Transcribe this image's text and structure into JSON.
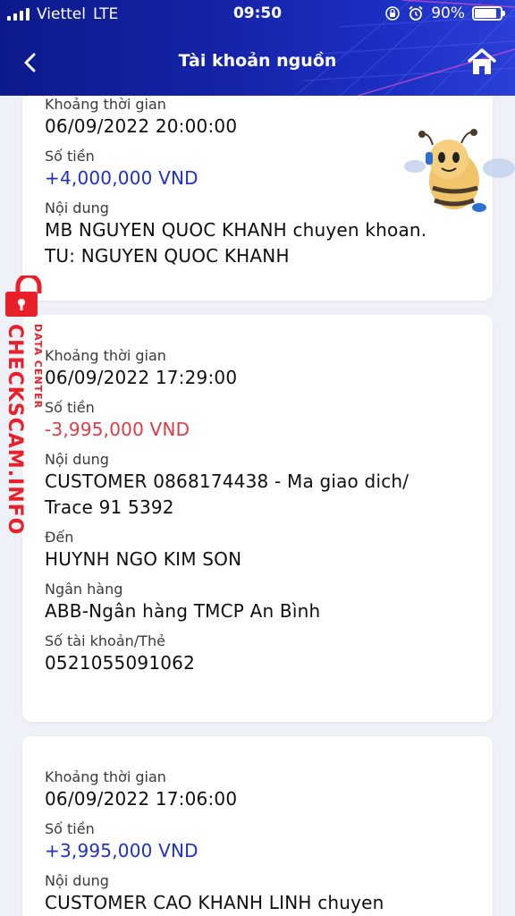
{
  "status_bar": {
    "carrier": "Viettel",
    "network": "LTE",
    "time": "09:50",
    "battery": "90%"
  },
  "header": {
    "title": "Tài khoản nguồn"
  },
  "watermark": {
    "main": "CHECKSCAM.INFO",
    "sub": "DATA CENTER"
  },
  "transactions": [
    {
      "time_label": "Khoảng thời gian",
      "time": "06/09/2022 20:00:00",
      "amount_label": "Số tiền",
      "amount": "+4,000,000 VND",
      "content_label": "Nội dung",
      "content": "MB NGUYEN QUOC KHANH chuyen khoan. TU: NGUYEN QUOC KHANH"
    },
    {
      "time_label": "Khoảng thời gian",
      "time": "06/09/2022 17:29:00",
      "amount_label": "Số tiền",
      "amount": "-3,995,000 VND",
      "content_label": "Nội dung",
      "content": "CUSTOMER 0868174438 - Ma giao dich/ Trace 91 5392",
      "to_label": "Đến",
      "to": "HUYNH NGO KIM SON",
      "bank_label": "Ngân hàng",
      "bank": "ABB-Ngân hàng TMCP An Bình",
      "account_label": "Số tài khoản/Thẻ",
      "account": "0521055091062"
    },
    {
      "time_label": "Khoảng thời gian",
      "time": "06/09/2022 17:06:00",
      "amount_label": "Số tiền",
      "amount": "+3,995,000 VND",
      "content_label": "Nội dung",
      "content": "CUSTOMER CAO KHANH LINH chuyen"
    }
  ],
  "colors": {
    "header_start": "#0d1a8c",
    "header_end": "#2a3fd6",
    "amount_positive": "#1f31c8",
    "amount_negative": "#e23a45",
    "watermark": "#e8202a"
  }
}
